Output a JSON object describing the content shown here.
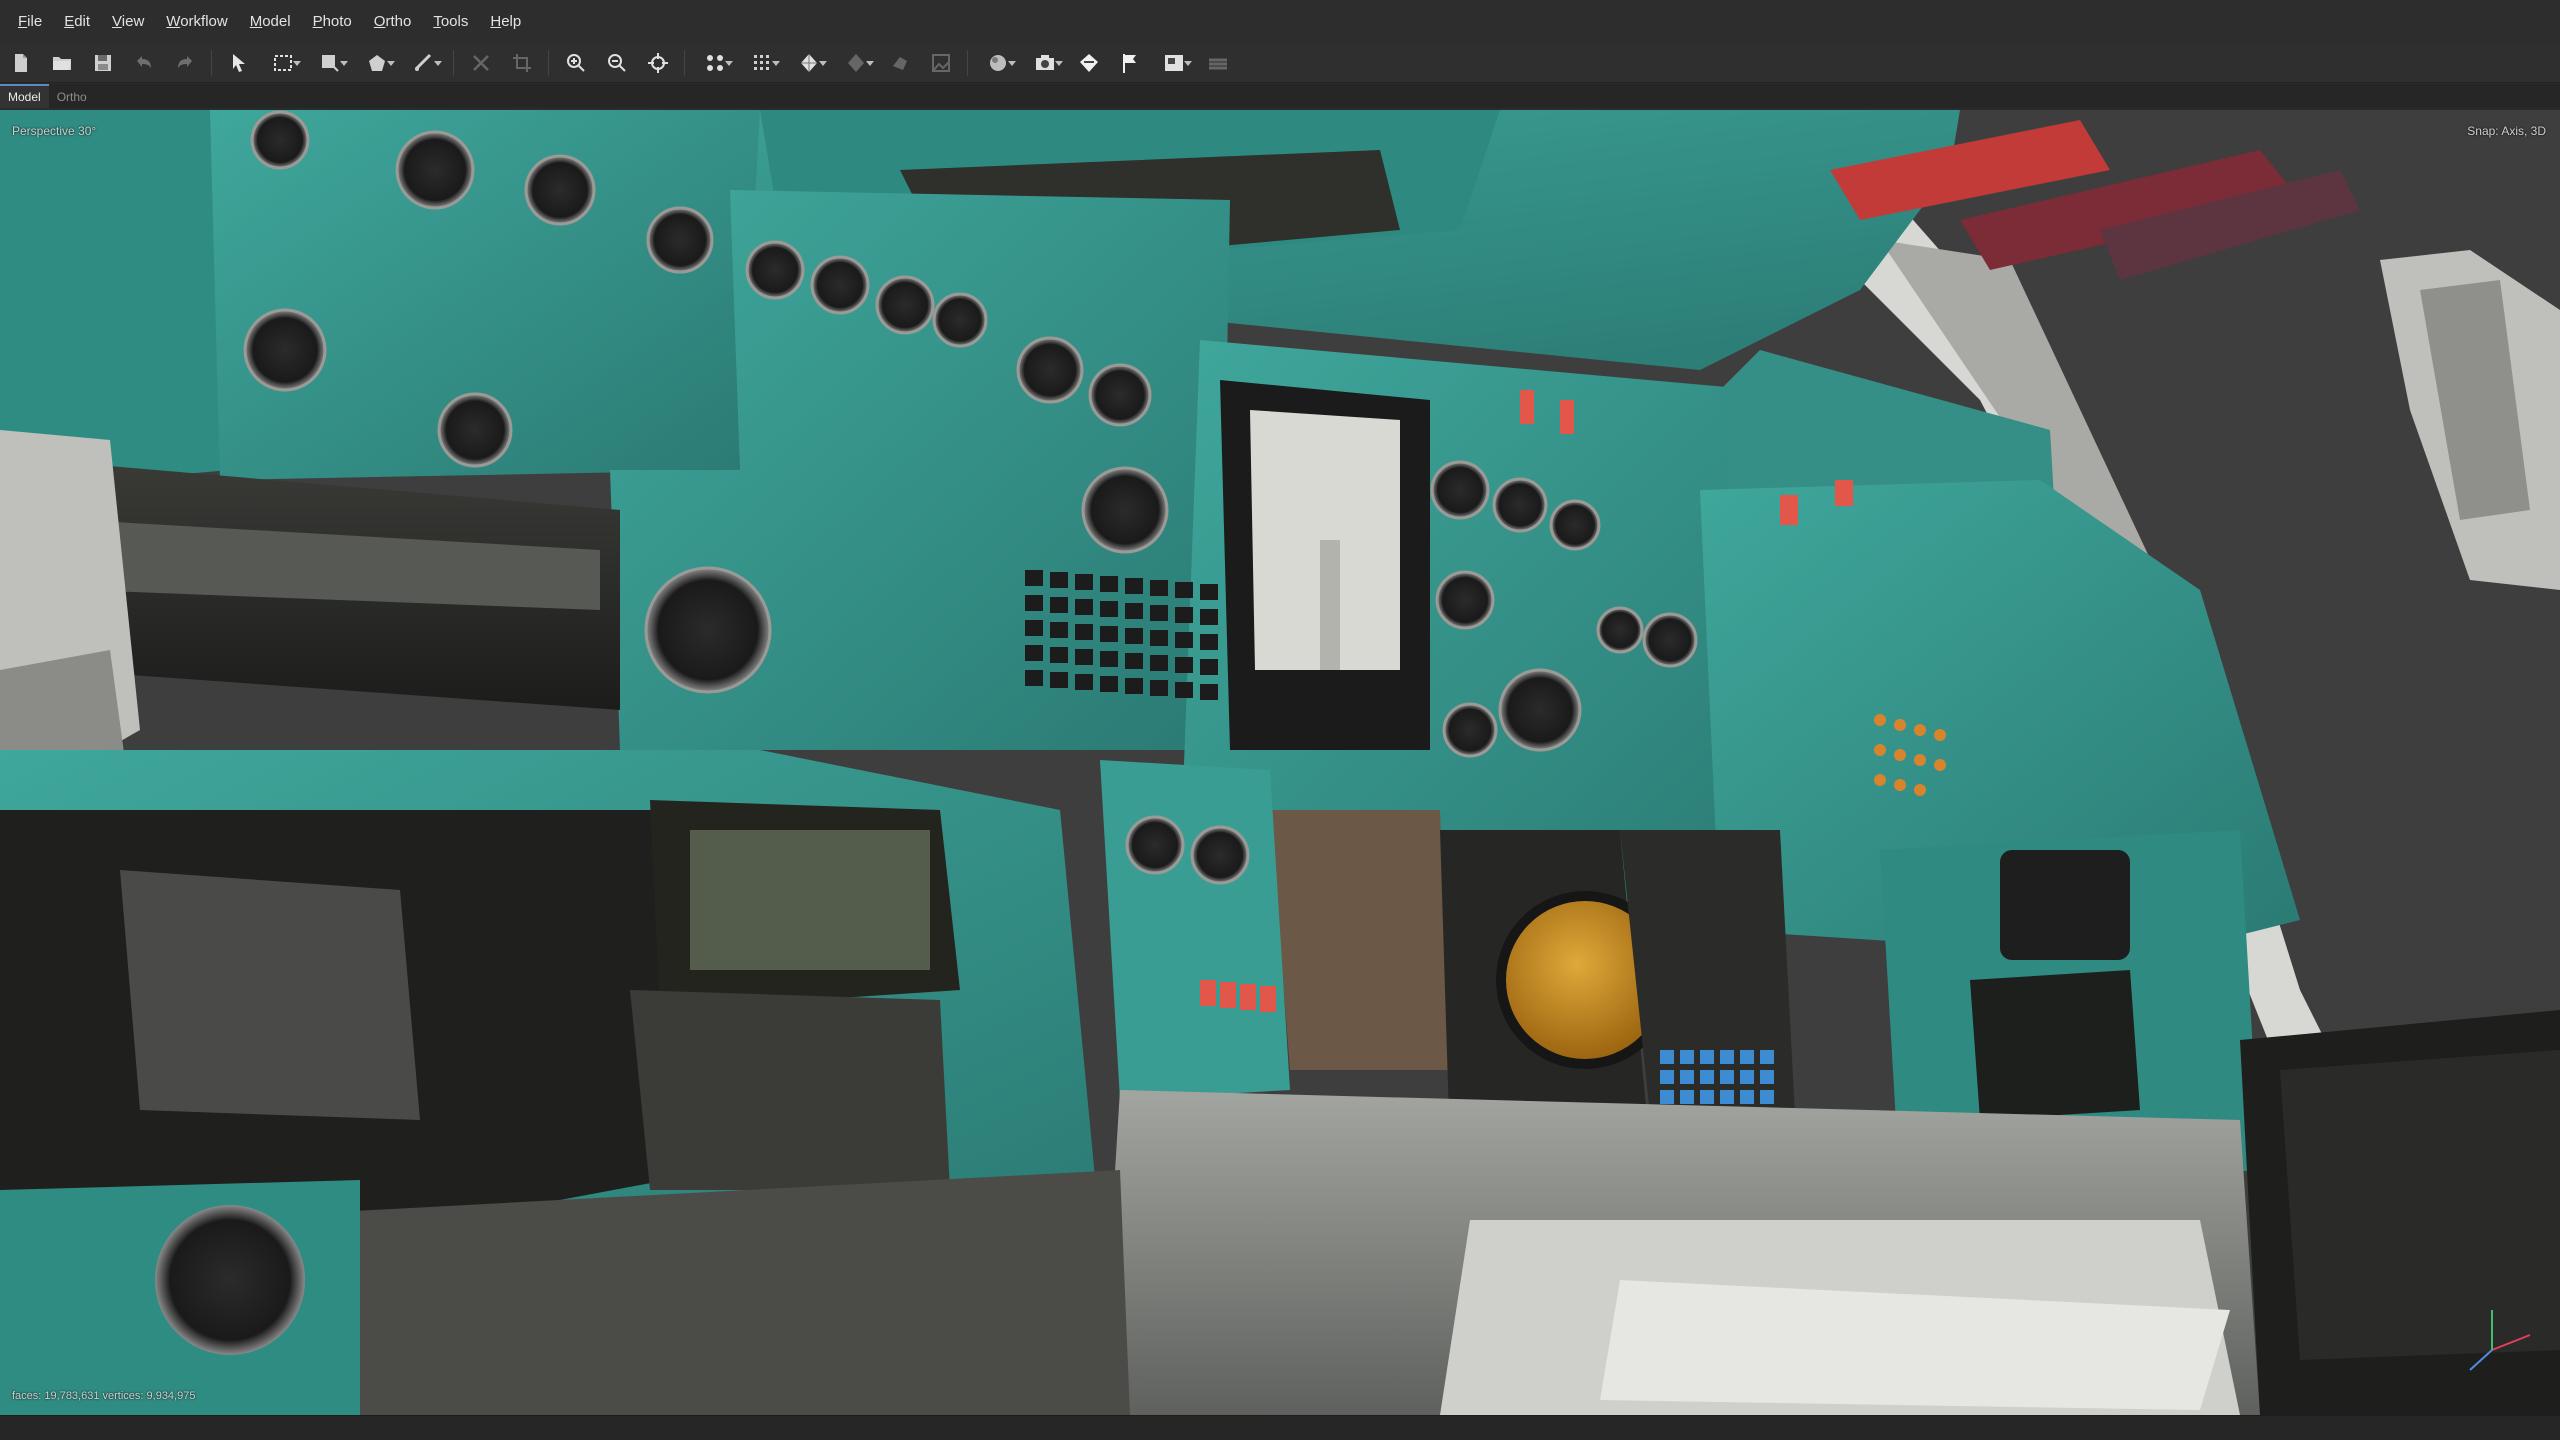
{
  "menu": [
    {
      "accel": "F",
      "rest": "ile"
    },
    {
      "accel": "E",
      "rest": "dit"
    },
    {
      "accel": "V",
      "rest": "iew"
    },
    {
      "accel": "W",
      "rest": "orkflow"
    },
    {
      "accel": "M",
      "rest": "odel"
    },
    {
      "accel": "P",
      "rest": "hoto"
    },
    {
      "accel": "O",
      "rest": "rtho"
    },
    {
      "accel": "T",
      "rest": "ools"
    },
    {
      "accel": "H",
      "rest": "elp"
    }
  ],
  "toolbar": {
    "icons": [
      "new-icon",
      "open-icon",
      "save-icon",
      "undo-icon",
      "redo-icon",
      "navigation-icon",
      "rectangle-selection-icon",
      "shape-icon",
      "polygon-icon",
      "ruler-icon",
      "delete-icon",
      "crop-icon",
      "zoom-in-icon",
      "zoom-out-icon",
      "reset-view-icon",
      "camera-points-icon",
      "grid-icon",
      "model-icon",
      "texture-icon",
      "tiled-model-icon",
      "orthomosaic-icon",
      "texture-mode-icon",
      "camera-icon",
      "region-icon",
      "marker-flag-icon",
      "image-icon",
      "layers-icon"
    ]
  },
  "tabs": [
    {
      "label": "Model",
      "active": true
    },
    {
      "label": "Ortho",
      "active": false
    }
  ],
  "viewport": {
    "projection_label": "Perspective 30°",
    "snap_label": "Snap: Axis, 3D",
    "stats_label": "faces: 19,783,631 vertices: 9,934,975"
  },
  "colors": {
    "panel_teal": "#3a9d93",
    "panel_dark_teal": "#2a7b74",
    "metal_gray": "#8d8f8b",
    "warning_red": "#c63b3a",
    "background": "#3e3e3e"
  }
}
